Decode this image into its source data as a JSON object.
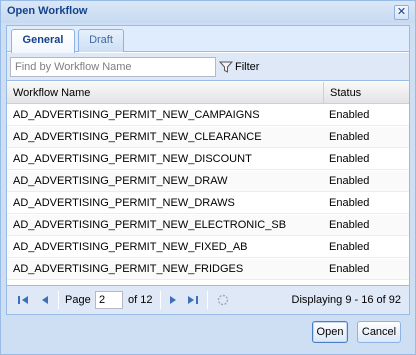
{
  "window": {
    "title": "Open Workflow",
    "close_label": "✕"
  },
  "tabs": [
    {
      "label": "General",
      "active": true
    },
    {
      "label": "Draft",
      "active": false
    }
  ],
  "search": {
    "placeholder": "Find by Workflow Name",
    "value": ""
  },
  "filter": {
    "label": "Filter",
    "icon": "filter-icon"
  },
  "grid": {
    "columns": [
      "Workflow Name",
      "Status"
    ],
    "rows": [
      {
        "name": "AD_ADVERTISING_PERMIT_NEW_CAMPAIGNS",
        "status": "Enabled"
      },
      {
        "name": "AD_ADVERTISING_PERMIT_NEW_CLEARANCE",
        "status": "Enabled"
      },
      {
        "name": "AD_ADVERTISING_PERMIT_NEW_DISCOUNT",
        "status": "Enabled"
      },
      {
        "name": "AD_ADVERTISING_PERMIT_NEW_DRAW",
        "status": "Enabled"
      },
      {
        "name": "AD_ADVERTISING_PERMIT_NEW_DRAWS",
        "status": "Enabled"
      },
      {
        "name": "AD_ADVERTISING_PERMIT_NEW_ELECTRONIC_SB",
        "status": "Enabled"
      },
      {
        "name": "AD_ADVERTISING_PERMIT_NEW_FIXED_AB",
        "status": "Enabled"
      },
      {
        "name": "AD_ADVERTISING_PERMIT_NEW_FRIDGES",
        "status": "Enabled"
      }
    ]
  },
  "pager": {
    "page_label": "Page",
    "page_value": "2",
    "of_label": "of 12",
    "display_text": "Displaying 9 - 16 of 92"
  },
  "buttons": {
    "open": "Open",
    "cancel": "Cancel"
  },
  "colors": {
    "accent": "#15428b",
    "border": "#99bbe8",
    "nav_icon": "#3f6fb5"
  }
}
